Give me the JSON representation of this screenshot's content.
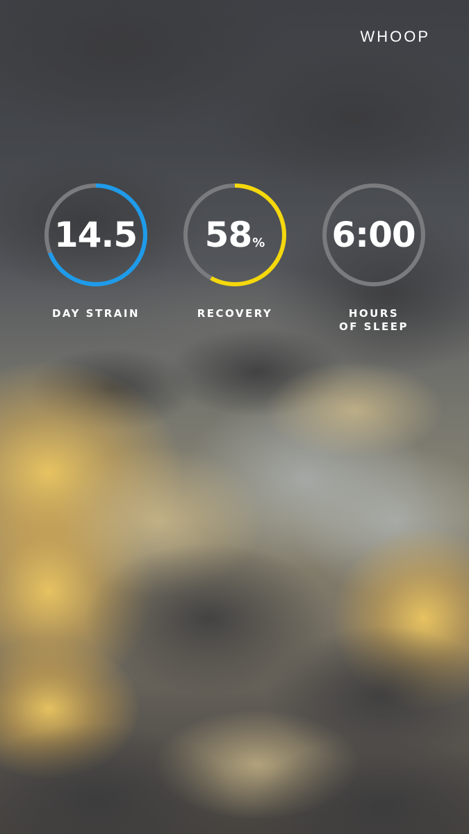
{
  "brand": {
    "logo_text": "WHOOP"
  },
  "metrics": [
    {
      "id": "strain",
      "value": "14.5",
      "unit": "",
      "label_lines": [
        "DAY STRAIN"
      ],
      "progress": 0.69,
      "ring_color": "#1e9bea"
    },
    {
      "id": "recovery",
      "value": "58",
      "unit": "%",
      "label_lines": [
        "RECOVERY"
      ],
      "progress": 0.58,
      "ring_color": "#f5d80c"
    },
    {
      "id": "sleep",
      "value": "6:00",
      "unit": "",
      "label_lines": [
        "HOURS",
        "OF SLEEP"
      ],
      "progress": 0,
      "ring_color": "#7a7b7e"
    }
  ],
  "colors": {
    "track": "#7a7b7e",
    "text": "#ffffff"
  }
}
